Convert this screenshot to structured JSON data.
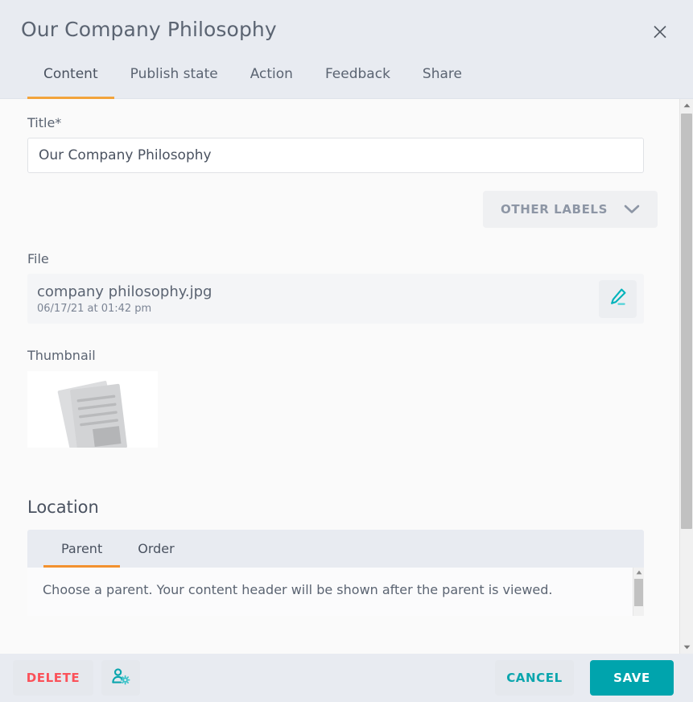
{
  "header": {
    "title": "Our Company Philosophy",
    "close_icon": "close-icon"
  },
  "tabs": [
    {
      "label": "Content",
      "active": true
    },
    {
      "label": "Publish state",
      "active": false
    },
    {
      "label": "Action",
      "active": false
    },
    {
      "label": "Feedback",
      "active": false
    },
    {
      "label": "Share",
      "active": false
    }
  ],
  "content": {
    "title_field": {
      "label": "Title*",
      "value": "Our Company Philosophy",
      "placeholder": "Title"
    },
    "other_labels": {
      "label": "OTHER LABELS",
      "chevron_icon": "chevron-down-icon"
    },
    "file": {
      "label": "File",
      "name": "company philosophy.jpg",
      "date": "06/17/21 at 01:42 pm",
      "edit_icon": "pencil-icon"
    },
    "thumbnail": {
      "label": "Thumbnail",
      "image_icon": "document-placeholder-icon"
    },
    "location": {
      "heading": "Location",
      "tabs": [
        {
          "label": "Parent",
          "active": true
        },
        {
          "label": "Order",
          "active": false
        }
      ],
      "description": "Choose a parent. Your content header will be shown after the parent is viewed."
    }
  },
  "footer": {
    "delete_label": "DELETE",
    "permissions_icon": "user-settings-icon",
    "cancel_label": "CANCEL",
    "save_label": "SAVE"
  },
  "colors": {
    "accent_orange": "#f2a33c",
    "accent_teal": "#00a4ad",
    "danger_red": "#fb5159",
    "header_bg": "#e8ebf1",
    "body_bg": "#fafafa"
  }
}
